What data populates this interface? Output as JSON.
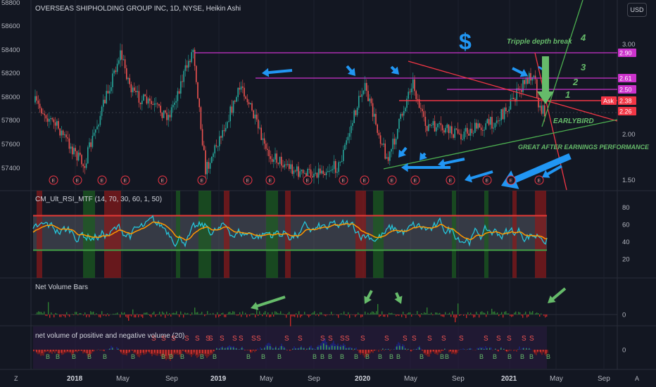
{
  "header": {
    "title": "OVERSEAS SHIPHOLDING GROUP INC, 1D, NYSE, Heikin Ashi",
    "currency_button": "USD"
  },
  "left_axis": {
    "ticks": [
      "58800",
      "58600",
      "58400",
      "58200",
      "58000",
      "57800",
      "57600",
      "57400"
    ]
  },
  "right_axis": {
    "ticks": [
      "3.00",
      "2.00",
      "1.50"
    ]
  },
  "price_labels": [
    {
      "text": "2.90",
      "color": "#cc33cc"
    },
    {
      "text": "2.61",
      "color": "#cc33cc"
    },
    {
      "text": "2.50",
      "color": "#cc33cc"
    },
    {
      "text": "Ask",
      "color": "#f23645"
    },
    {
      "text": "2.38",
      "color": "#f23645"
    },
    {
      "text": "2.26",
      "color": "#f23645"
    }
  ],
  "annotations": {
    "dollar": "$",
    "tripple": "Tripple depth break",
    "n4": "4",
    "n3": "3",
    "n2": "2",
    "n1": "1",
    "earlybird": "EARLYBIRD",
    "great": "GREAT AFTER EARNINGS PERFORMANCE"
  },
  "earnings_marker": "E",
  "panes": {
    "rsi": {
      "title": "CM_Ult_RSI_MTF (14, 70, 30, 60, 1, 50)",
      "ticks": [
        "80",
        "60",
        "40",
        "20"
      ]
    },
    "nvb": {
      "title": "Net Volume Bars",
      "ticks": [
        "0"
      ]
    },
    "nv": {
      "title": "net volume of positive and negative volume (20)",
      "ticks": [
        "0"
      ]
    }
  },
  "signal_labels": {
    "sell": "S",
    "buy": "B"
  },
  "time_axis": {
    "labels": [
      "2018",
      "May",
      "Sep",
      "2019",
      "May",
      "Sep",
      "2020",
      "May",
      "Sep",
      "2021",
      "May",
      "Sep"
    ],
    "corner_left": "Z",
    "corner_right": "A"
  },
  "colors": {
    "background": "#131722",
    "up": "#26a69a",
    "down": "#ef5350",
    "rsi_line": "#26c6da",
    "rsi_signal": "#ff9800",
    "magenta_line": "#cc33cc",
    "trend_red": "#f23645",
    "trend_green": "#4caf50",
    "arrow_blue": "#2196f3",
    "annotation_green": "#66bb6a"
  },
  "chart_data": {
    "type": "candlestick",
    "title": "OVERSEAS SHIPHOLDING GROUP INC, 1D, NYSE, Heikin Ashi",
    "right_axis_range": [
      1.45,
      3.1
    ],
    "key_levels": [
      2.9,
      2.61,
      2.5,
      2.38,
      2.26
    ],
    "price_path_approx": [
      {
        "x": "2017-10",
        "y": 2.35
      },
      {
        "x": "2017-12",
        "y": 2.05
      },
      {
        "x": "2018-02",
        "y": 1.65
      },
      {
        "x": "2018-05",
        "y": 2.9
      },
      {
        "x": "2018-06",
        "y": 2.45
      },
      {
        "x": "2018-09",
        "y": 2.2
      },
      {
        "x": "2018-11",
        "y": 2.95
      },
      {
        "x": "2018-12",
        "y": 1.6
      },
      {
        "x": "2019-03",
        "y": 2.55
      },
      {
        "x": "2019-05",
        "y": 1.8
      },
      {
        "x": "2019-08",
        "y": 1.55
      },
      {
        "x": "2019-11",
        "y": 1.65
      },
      {
        "x": "2020-01",
        "y": 2.55
      },
      {
        "x": "2020-03",
        "y": 1.7
      },
      {
        "x": "2020-05",
        "y": 2.6
      },
      {
        "x": "2020-06",
        "y": 2.1
      },
      {
        "x": "2020-09",
        "y": 2.0
      },
      {
        "x": "2020-12",
        "y": 2.15
      },
      {
        "x": "2021-03",
        "y": 2.7
      },
      {
        "x": "2021-03",
        "y": 2.26
      }
    ],
    "indicators": [
      {
        "name": "CM_Ult_RSI_MTF (14, 70, 30, 60, 1, 50)",
        "upper_band": 70,
        "lower_band": 30,
        "range": [
          10,
          90
        ]
      },
      {
        "name": "Net Volume Bars"
      },
      {
        "name": "net volume of positive and negative volume (20)"
      }
    ]
  }
}
